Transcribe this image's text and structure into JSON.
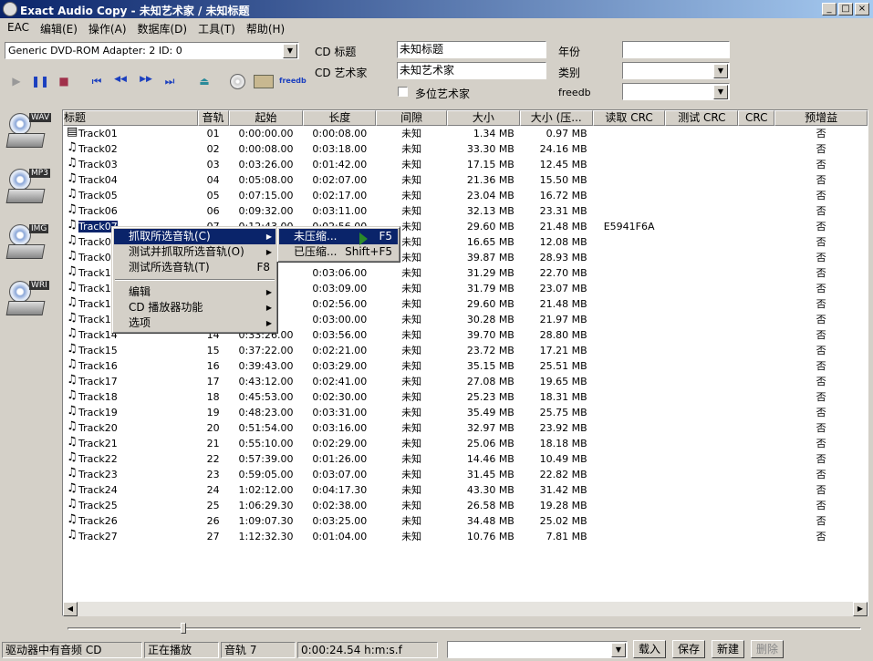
{
  "window": {
    "title": "Exact Audio Copy   -   未知艺术家 / 未知标题",
    "min": "_",
    "max": "□",
    "close": "×"
  },
  "menu": [
    "EAC",
    "编辑(E)",
    "操作(A)",
    "数据库(D)",
    "工具(T)",
    "帮助(H)"
  ],
  "drive_select": {
    "value": "Generic DVD-ROM   Adapter: 2  ID: 0"
  },
  "cd_info": {
    "title_label": "CD 标题",
    "title_value": "未知标题",
    "artist_label": "CD 艺术家",
    "artist_value": "未知艺术家",
    "various_label": "多位艺术家",
    "year_label": "年份",
    "year_value": "",
    "genre_label": "类别",
    "genre_value": "",
    "freedb_label": "freedb",
    "freedb_value": ""
  },
  "toolbar": {
    "play": "▶",
    "pause": "❚❚",
    "stop": "■",
    "prev": "⏮",
    "rewind": "◀◀",
    "forward": "▶▶",
    "next": "⏭",
    "eject": "⏏",
    "freedb": "freedb"
  },
  "side": [
    "WAV",
    "MP3",
    "IMG",
    "WRI"
  ],
  "columns": [
    "标题",
    "音轨",
    "起始",
    "长度",
    "间隙",
    "大小",
    "大小 (压...",
    "读取 CRC",
    "测试 CRC",
    "CRC",
    "预增益"
  ],
  "tracks": [
    [
      "Track01",
      "01",
      "0:00:00.00",
      "0:00:08.00",
      "未知",
      "1.34 MB",
      "0.97 MB",
      "",
      "",
      "",
      "否"
    ],
    [
      "Track02",
      "02",
      "0:00:08.00",
      "0:03:18.00",
      "未知",
      "33.30 MB",
      "24.16 MB",
      "",
      "",
      "",
      "否"
    ],
    [
      "Track03",
      "03",
      "0:03:26.00",
      "0:01:42.00",
      "未知",
      "17.15 MB",
      "12.45 MB",
      "",
      "",
      "",
      "否"
    ],
    [
      "Track04",
      "04",
      "0:05:08.00",
      "0:02:07.00",
      "未知",
      "21.36 MB",
      "15.50 MB",
      "",
      "",
      "",
      "否"
    ],
    [
      "Track05",
      "05",
      "0:07:15.00",
      "0:02:17.00",
      "未知",
      "23.04 MB",
      "16.72 MB",
      "",
      "",
      "",
      "否"
    ],
    [
      "Track06",
      "06",
      "0:09:32.00",
      "0:03:11.00",
      "未知",
      "32.13 MB",
      "23.31 MB",
      "",
      "",
      "",
      "否"
    ],
    [
      "Track07",
      "07",
      "0:12:43.00",
      "0:02:56.00",
      "未知",
      "29.60 MB",
      "21.48 MB",
      "E5941F6A",
      "",
      "",
      "否"
    ],
    [
      "Track08",
      "08",
      "",
      "",
      "未知",
      "16.65 MB",
      "12.08 MB",
      "",
      "",
      "",
      "否"
    ],
    [
      "Track09",
      "09",
      "",
      "",
      "未知",
      "39.87 MB",
      "28.93 MB",
      "",
      "",
      "",
      "否"
    ],
    [
      "Track10",
      "10",
      "5.00",
      "0:03:06.00",
      "未知",
      "31.29 MB",
      "22.70 MB",
      "",
      "",
      "",
      "否"
    ],
    [
      "Track11",
      "11",
      "1.00",
      "0:03:09.00",
      "未知",
      "31.79 MB",
      "23.07 MB",
      "",
      "",
      "",
      "否"
    ],
    [
      "Track12",
      "12",
      "0.00",
      "0:02:56.00",
      "未知",
      "29.60 MB",
      "21.48 MB",
      "",
      "",
      "",
      "否"
    ],
    [
      "Track13",
      "13",
      "6.00",
      "0:03:00.00",
      "未知",
      "30.28 MB",
      "21.97 MB",
      "",
      "",
      "",
      "否"
    ],
    [
      "Track14",
      "14",
      "0:33:26.00",
      "0:03:56.00",
      "未知",
      "39.70 MB",
      "28.80 MB",
      "",
      "",
      "",
      "否"
    ],
    [
      "Track15",
      "15",
      "0:37:22.00",
      "0:02:21.00",
      "未知",
      "23.72 MB",
      "17.21 MB",
      "",
      "",
      "",
      "否"
    ],
    [
      "Track16",
      "16",
      "0:39:43.00",
      "0:03:29.00",
      "未知",
      "35.15 MB",
      "25.51 MB",
      "",
      "",
      "",
      "否"
    ],
    [
      "Track17",
      "17",
      "0:43:12.00",
      "0:02:41.00",
      "未知",
      "27.08 MB",
      "19.65 MB",
      "",
      "",
      "",
      "否"
    ],
    [
      "Track18",
      "18",
      "0:45:53.00",
      "0:02:30.00",
      "未知",
      "25.23 MB",
      "18.31 MB",
      "",
      "",
      "",
      "否"
    ],
    [
      "Track19",
      "19",
      "0:48:23.00",
      "0:03:31.00",
      "未知",
      "35.49 MB",
      "25.75 MB",
      "",
      "",
      "",
      "否"
    ],
    [
      "Track20",
      "20",
      "0:51:54.00",
      "0:03:16.00",
      "未知",
      "32.97 MB",
      "23.92 MB",
      "",
      "",
      "",
      "否"
    ],
    [
      "Track21",
      "21",
      "0:55:10.00",
      "0:02:29.00",
      "未知",
      "25.06 MB",
      "18.18 MB",
      "",
      "",
      "",
      "否"
    ],
    [
      "Track22",
      "22",
      "0:57:39.00",
      "0:01:26.00",
      "未知",
      "14.46 MB",
      "10.49 MB",
      "",
      "",
      "",
      "否"
    ],
    [
      "Track23",
      "23",
      "0:59:05.00",
      "0:03:07.00",
      "未知",
      "31.45 MB",
      "22.82 MB",
      "",
      "",
      "",
      "否"
    ],
    [
      "Track24",
      "24",
      "1:02:12.00",
      "0:04:17.30",
      "未知",
      "43.30 MB",
      "31.42 MB",
      "",
      "",
      "",
      "否"
    ],
    [
      "Track25",
      "25",
      "1:06:29.30",
      "0:02:38.00",
      "未知",
      "26.58 MB",
      "19.28 MB",
      "",
      "",
      "",
      "否"
    ],
    [
      "Track26",
      "26",
      "1:09:07.30",
      "0:03:25.00",
      "未知",
      "34.48 MB",
      "25.02 MB",
      "",
      "",
      "",
      "否"
    ],
    [
      "Track27",
      "27",
      "1:12:32.30",
      "0:01:04.00",
      "未知",
      "10.76 MB",
      "7.81 MB",
      "",
      "",
      "",
      "否"
    ]
  ],
  "context_menu": [
    {
      "label": "抓取所选音轨(C)",
      "sub": true,
      "selected": true
    },
    {
      "label": "测试并抓取所选音轨(O)",
      "sub": true
    },
    {
      "label": "测试所选音轨(T)",
      "acc": "F8"
    },
    {
      "sep": true
    },
    {
      "label": "编辑",
      "sub": true
    },
    {
      "label": "CD 播放器功能",
      "sub": true
    },
    {
      "label": "选项",
      "sub": true
    }
  ],
  "submenu": [
    {
      "label": "未压缩...",
      "acc": "F5",
      "selected": true
    },
    {
      "label": "已压缩...",
      "acc": "Shift+F5"
    }
  ],
  "status": {
    "drive": "驱动器中有音频 CD",
    "state": "正在播放",
    "track": "音轨 7",
    "time": "0:00:24.54 h:m:s.f"
  },
  "buttons": {
    "load": "载入",
    "save": "保存",
    "new": "新建",
    "delete": "删除"
  }
}
